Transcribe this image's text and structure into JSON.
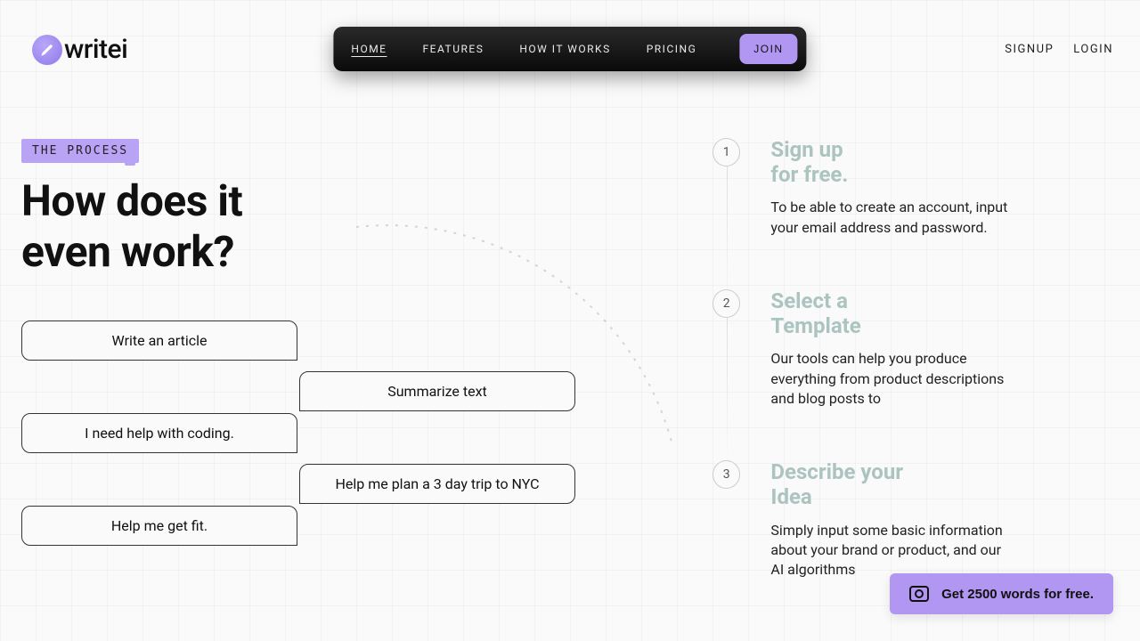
{
  "brand": {
    "name": "writei"
  },
  "nav": {
    "items": [
      {
        "label": "HOME",
        "active": true
      },
      {
        "label": "FEATURES",
        "active": false
      },
      {
        "label": "HOW IT WORKS",
        "active": false
      },
      {
        "label": "PRICING",
        "active": false
      }
    ],
    "join": "JOIN",
    "auth": {
      "signup": "SIGNUP",
      "login": "LOGIN"
    }
  },
  "section": {
    "tag": "THE PROCESS",
    "heading_line1": "How does it",
    "heading_line2": "even work?"
  },
  "prompts": [
    {
      "text": "Write an article",
      "side": "left"
    },
    {
      "text": "Summarize text",
      "side": "right"
    },
    {
      "text": "I need help with coding.",
      "side": "left"
    },
    {
      "text": "Help me plan a 3 day trip to NYC",
      "side": "right"
    },
    {
      "text": "Help me get fit.",
      "side": "left"
    }
  ],
  "steps": [
    {
      "num": "1",
      "title_line1": "Sign up",
      "title_line2": "for free.",
      "desc": "To be able to create an account, input your email address and password."
    },
    {
      "num": "2",
      "title_line1": "Select a",
      "title_line2": "Template",
      "desc": "Our tools can help you produce everything from product descriptions and blog posts to"
    },
    {
      "num": "3",
      "title_line1": "Describe your",
      "title_line2": "Idea",
      "desc": "Simply input some basic information about your brand or product, and our AI algorithms"
    }
  ],
  "cta": {
    "label": "Get 2500 words for free."
  }
}
